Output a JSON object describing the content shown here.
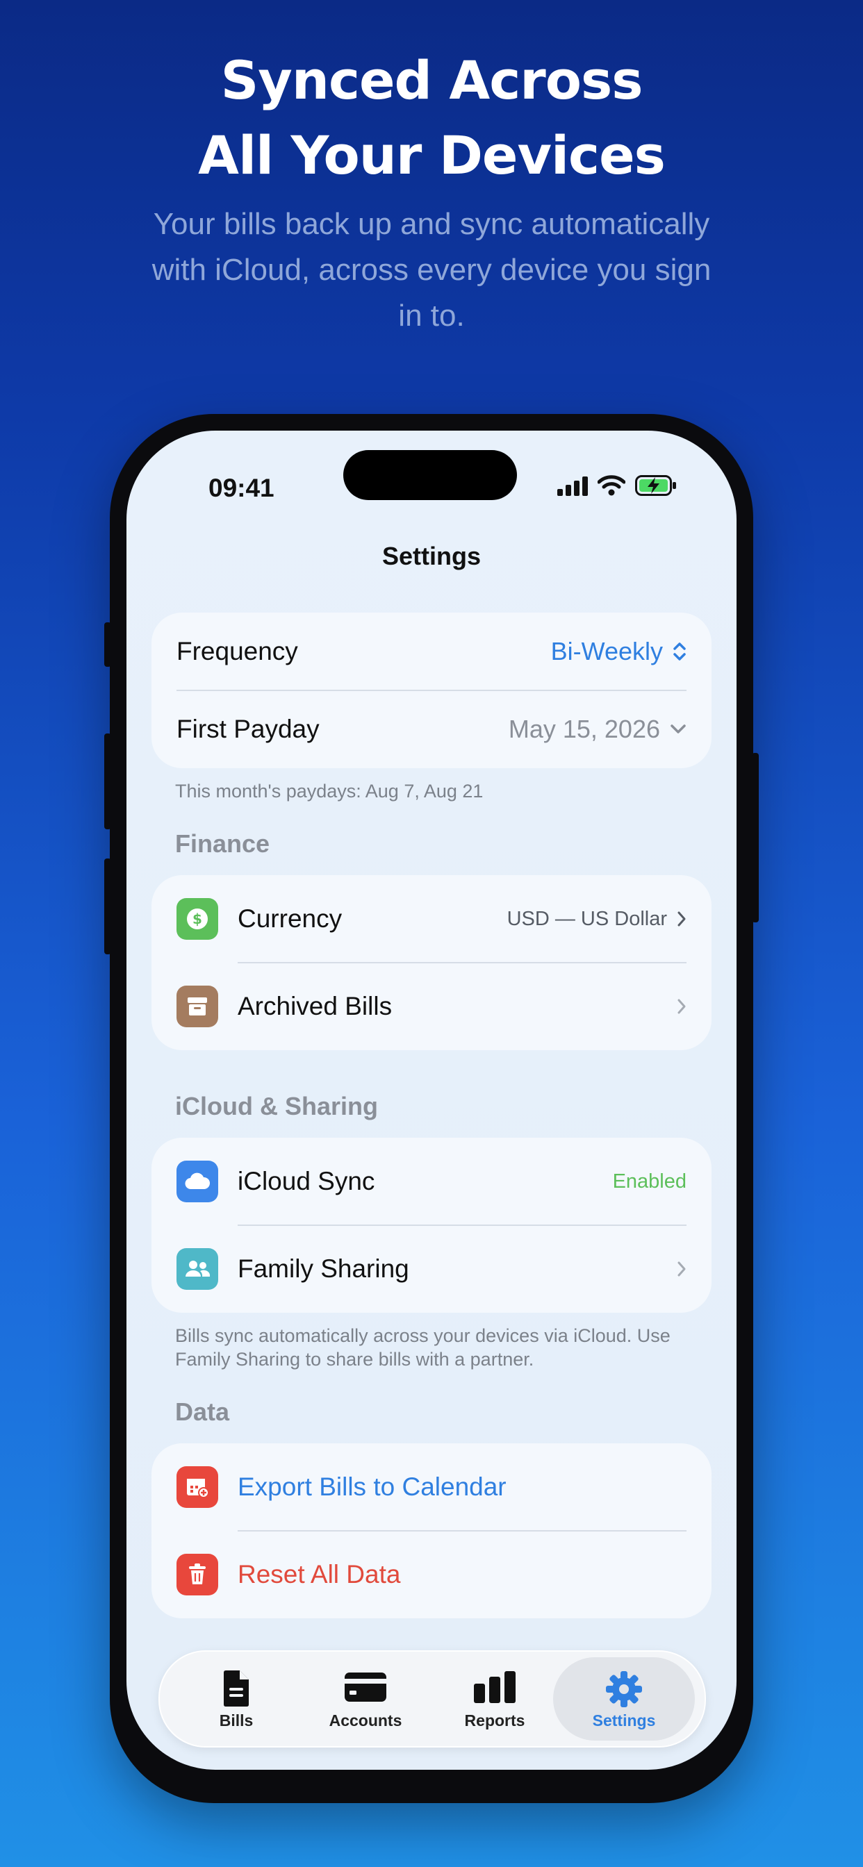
{
  "marketing": {
    "headline_line1": "Synced Across",
    "headline_line2": "All Your Devices",
    "subline": "Your bills back up and sync automatically with iCloud, across every device you sign in to."
  },
  "status_bar": {
    "time": "09:41"
  },
  "nav": {
    "title": "Settings"
  },
  "pay_schedule": {
    "frequency_label": "Frequency",
    "frequency_value": "Bi-Weekly",
    "first_payday_label": "First Payday",
    "first_payday_value": "May 15, 2026",
    "footnote": "This month's paydays: Aug 7, Aug 21"
  },
  "finance": {
    "header": "Finance",
    "currency_label": "Currency",
    "currency_value": "USD — US Dollar",
    "archived_label": "Archived Bills"
  },
  "icloud": {
    "header": "iCloud & Sharing",
    "sync_label": "iCloud Sync",
    "sync_value": "Enabled",
    "family_label": "Family Sharing",
    "footnote": "Bills sync automatically across your devices via iCloud. Use Family Sharing to share bills with a partner."
  },
  "data": {
    "header": "Data",
    "export_label": "Export Bills to Calendar",
    "reset_label": "Reset All Data"
  },
  "tabs": [
    {
      "label": "Bills",
      "icon": "document-icon"
    },
    {
      "label": "Accounts",
      "icon": "card-icon"
    },
    {
      "label": "Reports",
      "icon": "bar-chart-icon"
    },
    {
      "label": "Settings",
      "icon": "gear-icon",
      "active": true
    }
  ],
  "colors": {
    "accent_blue": "#2f7fe0",
    "enabled_green": "#5cbf5a",
    "destructive_red": "#e14a3c",
    "currency_tile": "#5cbf5a",
    "archive_tile": "#a47c5f",
    "icloud_tile": "#3d87ea",
    "family_tile": "#4fb8c8",
    "export_tile": "#e8473c",
    "reset_tile": "#e8473c"
  }
}
